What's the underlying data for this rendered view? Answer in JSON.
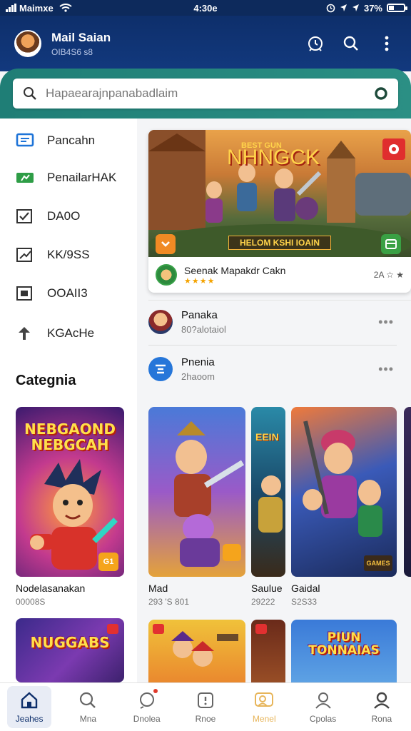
{
  "status_bar": {
    "carrier": "Maimxe",
    "time": "4:30e",
    "battery": "37%",
    "battery_level": 0.37
  },
  "header": {
    "user_name": "Mail Saian",
    "user_sub": "OIB4S6 s8"
  },
  "search": {
    "placeholder": "Hapaearajnpanabadlaim"
  },
  "sidebar": {
    "items": [
      {
        "label": "Pancahn",
        "icon": "chat-icon"
      },
      {
        "label": "PenailarHAK",
        "icon": "ticket-icon"
      },
      {
        "label": "DA0O",
        "icon": "checkbox-icon"
      },
      {
        "label": "KK/9SS",
        "icon": "chart-icon"
      },
      {
        "label": "OOAII3",
        "icon": "calendar-icon"
      },
      {
        "label": "KGAcHe",
        "icon": "pin-icon"
      }
    ],
    "category_title": "Categnia"
  },
  "featured": {
    "banner_title": "NHNGCK",
    "banner_kicker": "BEST GUN",
    "banner_caption": "HELOM KSHI IOAIN",
    "name": "Seenak Mapakdr Cakn",
    "stars": "★★★★",
    "count": "2A ☆ ★"
  },
  "list_items": [
    {
      "title": "Panaka",
      "sub": "80?alotaiol"
    },
    {
      "title": "Pnenia",
      "sub": "2haoom"
    }
  ],
  "category_cards": [
    {
      "title": "Nodelasanakan",
      "meta": "00008S",
      "banner": "NEBGAOND NEBGCAH",
      "badge": "G1"
    },
    {
      "title": "",
      "meta": "",
      "banner": "NUGGABS",
      "badge": ""
    }
  ],
  "game_cards": [
    {
      "title": "Mad",
      "meta": "293 'S 801"
    },
    {
      "title": "Saulue",
      "meta": "29222"
    },
    {
      "title": "Gaidal",
      "meta": "S2S33"
    },
    {
      "title": "",
      "meta": "",
      "banner": ""
    },
    {
      "title": "",
      "meta": "",
      "banner": ""
    },
    {
      "title": "",
      "meta": "",
      "banner": "PIUN TONNAIAS"
    }
  ],
  "small_art": {
    "panel_2": "EEIN",
    "game_3_badge": "GAMES"
  },
  "bottom_nav": [
    {
      "label": "Jeahes",
      "icon": "home-icon",
      "active": true
    },
    {
      "label": "Mna",
      "icon": "search-icon"
    },
    {
      "label": "Dnolea",
      "icon": "alert-icon",
      "dot": true
    },
    {
      "label": "Rnoe",
      "icon": "info-icon"
    },
    {
      "label": "Menel",
      "icon": "people-icon",
      "accent": true
    },
    {
      "label": "Cpolas",
      "icon": "user-icon"
    },
    {
      "label": "Rona",
      "icon": "profile-icon"
    }
  ],
  "colors": {
    "header": "#0e2f6b",
    "search_band": "#2b8f84",
    "accent_gold": "#e7b55a"
  }
}
